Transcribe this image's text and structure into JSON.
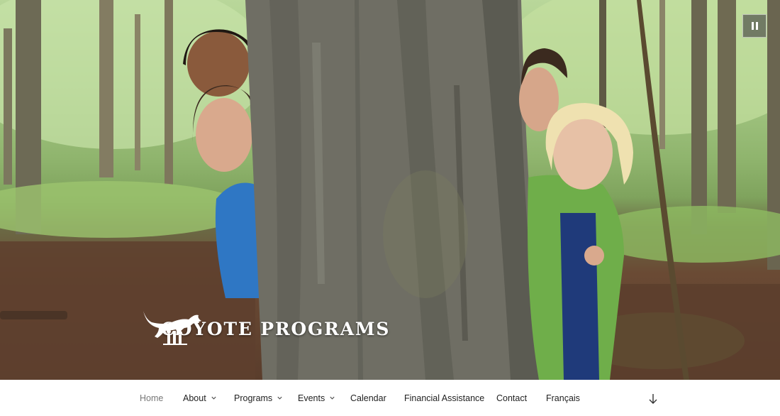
{
  "header": {
    "site_title": "COYOTE PROGRAMS",
    "logo_icon": "coyote-logo-icon",
    "pause_icon": "pause-icon"
  },
  "navigation": {
    "items": [
      {
        "label": "Home",
        "has_dropdown": false,
        "current": true
      },
      {
        "label": "About",
        "has_dropdown": true,
        "current": false
      },
      {
        "label": "Programs",
        "has_dropdown": true,
        "current": false
      },
      {
        "label": "Events",
        "has_dropdown": true,
        "current": false
      },
      {
        "label": "Calendar",
        "has_dropdown": false,
        "current": false
      },
      {
        "label": "Financial Assistance",
        "has_dropdown": false,
        "current": false
      },
      {
        "label": "Contact",
        "has_dropdown": false,
        "current": false
      },
      {
        "label": "Français",
        "has_dropdown": false,
        "current": false
      }
    ],
    "scroll_icon": "arrow-down-icon"
  },
  "colors": {
    "nav_text": "#222222",
    "nav_current": "#777777",
    "title_text": "#ffffff"
  }
}
